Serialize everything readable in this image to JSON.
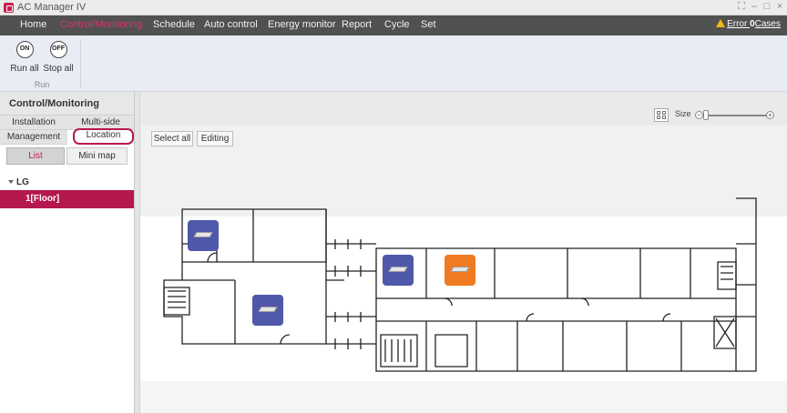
{
  "window": {
    "title": "AC Manager IV",
    "controls": [
      "⛶",
      "–",
      "□",
      "×"
    ]
  },
  "menu": {
    "items": [
      {
        "label": "Home",
        "active": false
      },
      {
        "label": "Control/Monitoring",
        "active": true
      },
      {
        "label": "Schedule",
        "active": false
      },
      {
        "label": "Auto control",
        "active": false
      },
      {
        "label": "Energy monitor",
        "active": false
      },
      {
        "label": "Report",
        "active": false
      },
      {
        "label": "Cycle",
        "active": false
      },
      {
        "label": "Set",
        "active": false
      }
    ],
    "error": {
      "prefix": "Error ",
      "count": "0",
      "suffix": "Cases"
    }
  },
  "ribbon": {
    "run_all": {
      "icon_text": "ON",
      "label": "Run all"
    },
    "stop_all": {
      "icon_text": "OFF",
      "label": "Stop all"
    },
    "group_label": "Run"
  },
  "left_panel": {
    "title": "Control/Monitoring",
    "tabs": [
      "Installation",
      "Multi-side",
      "Management",
      "Location"
    ],
    "active_tab": "Location",
    "subtabs": [
      "List",
      "Mini map"
    ],
    "active_subtab": "List",
    "tree": {
      "root": "LG",
      "selected": "1[Floor]"
    }
  },
  "main": {
    "toolbar": {
      "select_all": "Select all",
      "editing": "Editing"
    },
    "size": {
      "label": "Size",
      "minus": "−",
      "plus": "+"
    },
    "units": [
      {
        "id": "unit-1",
        "color": "#4f58a9",
        "icon": "ceiling-cassette-icon"
      },
      {
        "id": "unit-2",
        "color": "#4f58a9",
        "icon": "ceiling-cassette-icon"
      },
      {
        "id": "unit-3",
        "color": "#4f58a9",
        "icon": "ceiling-cassette-icon"
      },
      {
        "id": "unit-4",
        "color": "#f07a22",
        "icon": "ceiling-cassette-icon"
      }
    ]
  },
  "colors": {
    "accent": "#c81d4e",
    "menubar": "#515151",
    "unit_off": "#4f58a9",
    "unit_on": "#f07a22"
  }
}
